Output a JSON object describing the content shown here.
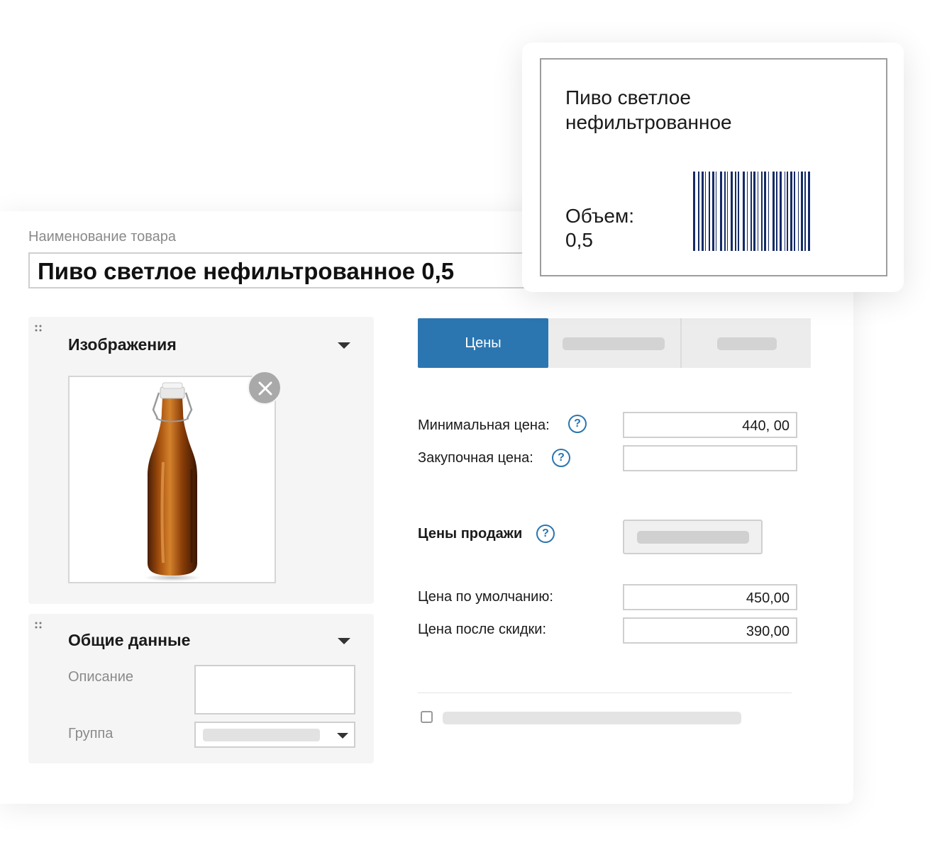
{
  "product": {
    "name_label": "Наименование товара",
    "name_value": "Пиво светлое нефильтрованное 0,5"
  },
  "label_card": {
    "title": "Пиво светлое нефильтрованное",
    "volume_label": "Объем:",
    "volume_value": "0,5",
    "barcode_color": "#152b66",
    "barcode_icon": "barcode-icon"
  },
  "images_panel": {
    "title": "Изображения",
    "drag_icon": "drag-handle-icon",
    "caret_icon": "chevron-down-icon",
    "remove_icon": "close-icon"
  },
  "general_panel": {
    "title": "Общие данные",
    "description_label": "Описание",
    "group_label": "Группа"
  },
  "tabs": {
    "active_label": "Цены",
    "active_color": "#2b76b0"
  },
  "prices": {
    "min_price_label": "Минимальная цена:",
    "min_price_value": "440, 00",
    "purchase_price_label": "Закупочная цена:",
    "purchase_price_value": "",
    "sale_prices_label": "Цены продажи",
    "default_price_label": "Цена по умолчанию:",
    "default_price_value": "450,00",
    "discount_price_label": "Цена после скидки:",
    "discount_price_value": "390,00",
    "help_glyph": "?"
  }
}
